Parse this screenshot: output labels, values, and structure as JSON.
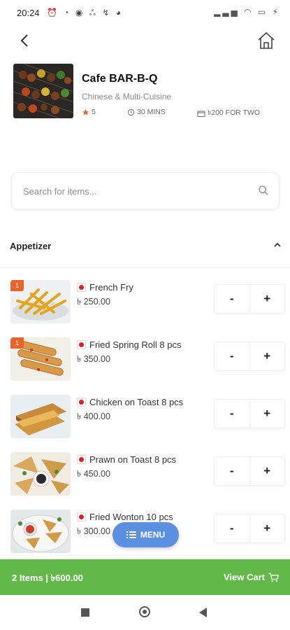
{
  "status_bar": {
    "time": "20:24"
  },
  "restaurant": {
    "name": "Cafe BAR-B-Q",
    "cuisine": "Chinese & Multi-Cuisine",
    "rating": "5",
    "time": "30 MINS",
    "cost": "৳200 FOR TWO"
  },
  "search": {
    "placeholder": "Search for items..."
  },
  "section": {
    "title": "Appetizer"
  },
  "items": [
    {
      "name": "French Fry",
      "price": "৳ 250.00",
      "badge": "1"
    },
    {
      "name": "Fried Spring Roll 8 pcs",
      "price": "৳ 350.00",
      "badge": "1"
    },
    {
      "name": "Chicken on Toast 8 pcs",
      "price": "৳ 400.00",
      "badge": ""
    },
    {
      "name": "Prawn on Toast 8 pcs",
      "price": "৳ 450.00",
      "badge": ""
    },
    {
      "name": "Fried Wonton 10 pcs",
      "price": "৳ 300.00",
      "badge": ""
    }
  ],
  "stepper": {
    "minus": "-",
    "plus": "+"
  },
  "menu_button": {
    "label": "MENU"
  },
  "cart_bar": {
    "summary": "2 Items  |  ৳600.00",
    "view_label": "View Cart"
  },
  "colors": {
    "accent_green": "#63b84a",
    "menu_blue": "#5b8fe0",
    "badge_orange": "#e8642a",
    "rating_star": "#e8642a"
  }
}
